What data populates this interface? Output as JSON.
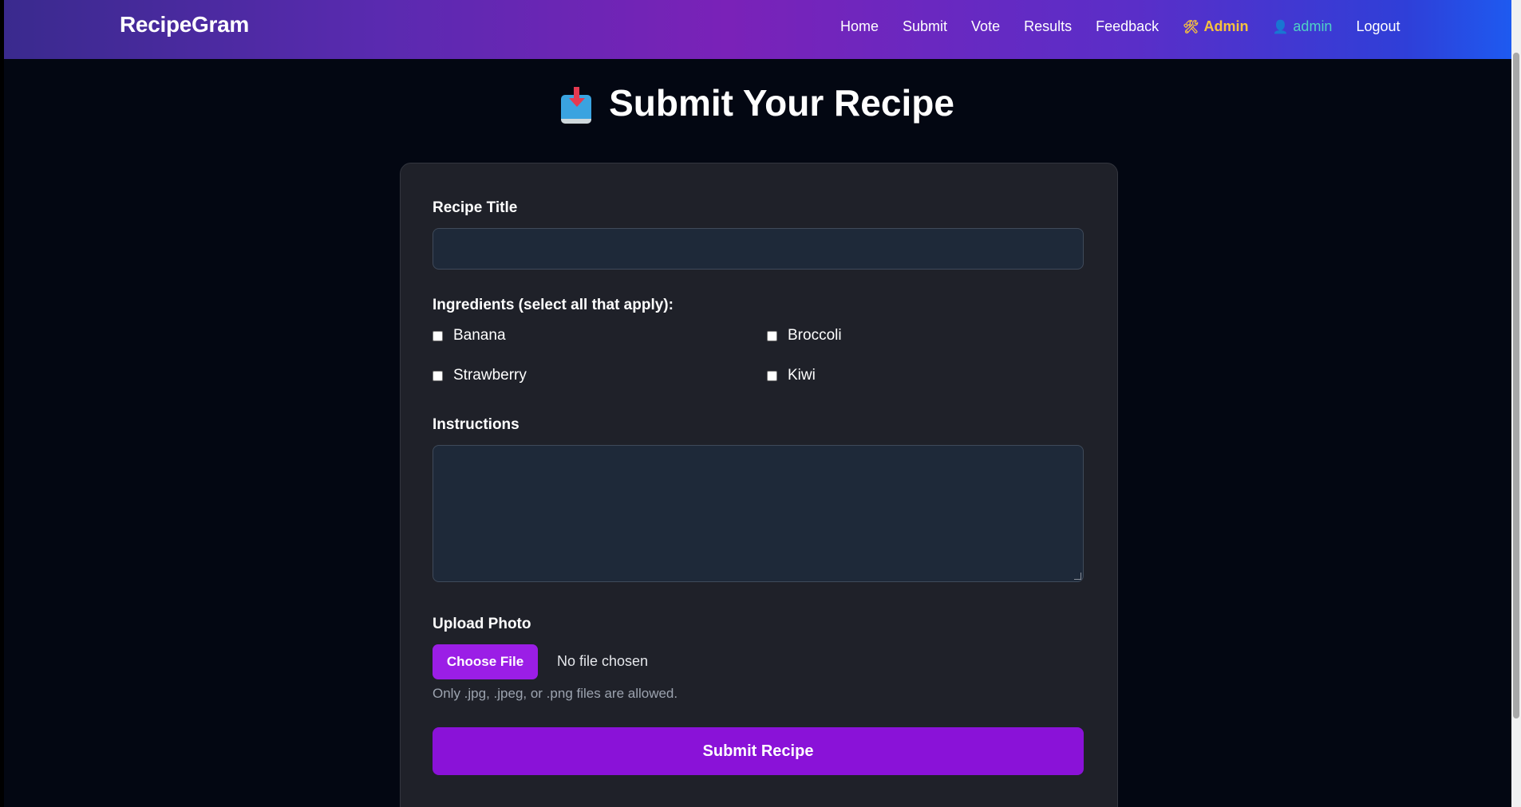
{
  "navbar": {
    "brand": "RecipeGram",
    "links": {
      "home": "Home",
      "submit": "Submit",
      "vote": "Vote",
      "results": "Results",
      "feedback": "Feedback",
      "admin": "Admin",
      "user": "admin",
      "logout": "Logout"
    },
    "admin_icon": "hammer-wrench-icon",
    "user_icon": "user-silhouette-icon"
  },
  "page": {
    "title": "Submit Your Recipe",
    "title_icon": "inbox-tray-icon"
  },
  "form": {
    "title_label": "Recipe Title",
    "title_value": "",
    "ingredients_label": "Ingredients (select all that apply):",
    "ingredients": [
      {
        "label": "Banana",
        "checked": false
      },
      {
        "label": "Broccoli",
        "checked": false
      },
      {
        "label": "Strawberry",
        "checked": false
      },
      {
        "label": "Kiwi",
        "checked": false
      }
    ],
    "instructions_label": "Instructions",
    "instructions_value": "",
    "upload_label": "Upload Photo",
    "choose_file_label": "Choose File",
    "file_status": "No file chosen",
    "file_hint": "Only .jpg, .jpeg, or .png files are allowed.",
    "submit_label": "Submit Recipe"
  },
  "colors": {
    "accent": "#8a12d8",
    "admin_link": "#f6c23e",
    "user_link": "#4fd1c5",
    "background": "#030712",
    "card": "#1f2129"
  }
}
